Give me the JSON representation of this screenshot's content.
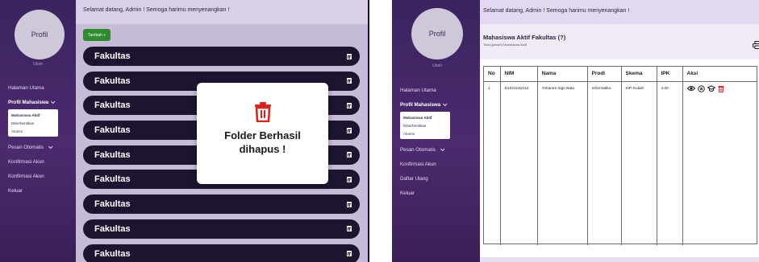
{
  "left": {
    "sidebar": {
      "avatar_label": "Profil",
      "avatar_caption": "Ubah",
      "menu": [
        {
          "label": "Halaman Utama"
        },
        {
          "label": "Profil Mahasiswa",
          "expanded": true
        },
        {
          "label": "Pesan Otomatis",
          "expandable": true
        },
        {
          "label": "Konfirmasi Akun"
        },
        {
          "label": "Konfirmasi Akun"
        },
        {
          "label": "Keluar"
        }
      ],
      "submenu": [
        "Mahasiswa Aktif",
        "Diberhentikan",
        "Alumni"
      ]
    },
    "header_text": "Selamat datang, Admin ! Semoga harimu menyenangkan !",
    "add_button": "Tambah +",
    "folders": [
      "Fakultas",
      "Fakultas",
      "Fakultas",
      "Fakultas",
      "Fakultas",
      "Fakultas",
      "Fakultas",
      "Fakultas",
      "Fakultas"
    ],
    "modal": {
      "line1": "Folder Berhasil",
      "line2": "dihapus !",
      "icon": "trash-icon",
      "icon_color": "#e0201b"
    }
  },
  "right": {
    "sidebar": {
      "avatar_label": "Profil",
      "avatar_caption": "Ubah",
      "menu": [
        {
          "label": "Halaman Utama"
        },
        {
          "label": "Profil Mahasiswa",
          "expanded": true
        },
        {
          "label": "Pesan Otomatis",
          "expandable": true
        },
        {
          "label": "Konfirmasi Akun"
        },
        {
          "label": "Daftar Ulang"
        },
        {
          "label": "Keluar"
        }
      ],
      "submenu": [
        "Mahasiswa Aktif",
        "Diberhentikan",
        "Alumni"
      ]
    },
    "header_text": "Selamat datang, Admin ! Semoga harimu menyenangkan !",
    "card_title": "Mahasiswa Aktif Fakultas (?)",
    "card_subtitle": "Total (jumlah) Mahasiswa Aktif",
    "table": {
      "headers": [
        "No",
        "NIM",
        "Nama",
        "Prodi",
        "Skema",
        "IPK",
        "Aksi"
      ],
      "rows": [
        [
          "1",
          "D1041191012",
          "Yohanes Sigo Bala",
          "Informatika",
          "KIP-Kuliah",
          "4.00"
        ]
      ],
      "action_icons": [
        "eye-icon",
        "cancel-circle-icon",
        "graduation-cap-icon",
        "trash-icon"
      ]
    }
  },
  "colors": {
    "sidebar": "#4b2b6e",
    "folder_row": "#1d1431",
    "add_button": "#2e8b2e",
    "danger": "#e0201b"
  }
}
